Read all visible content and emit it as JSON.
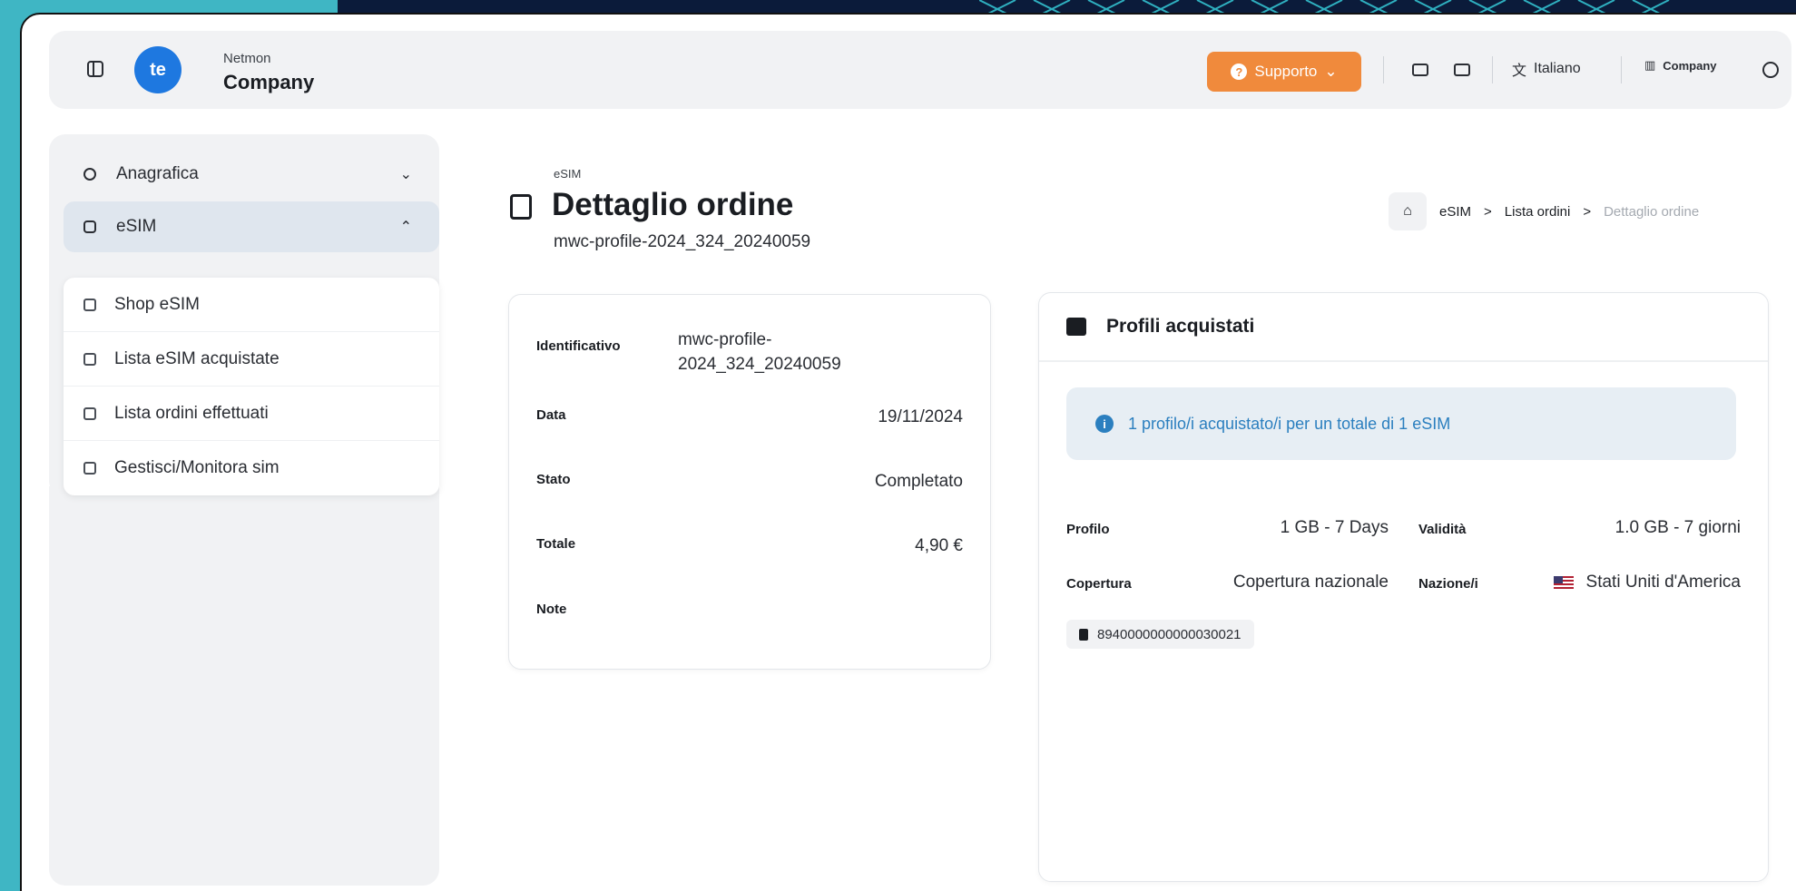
{
  "app": {
    "brand_small": "Netmon",
    "brand_name": "Company",
    "logo_text": "te"
  },
  "header": {
    "support_label": "Supporto",
    "language_label": "Italiano",
    "company_label": "Company"
  },
  "sidebar": {
    "items": [
      {
        "label": "Anagrafica",
        "chevron": "⌄"
      },
      {
        "label": "eSIM",
        "chevron": "⌃"
      }
    ],
    "submenu": [
      {
        "label": "Shop eSIM"
      },
      {
        "label": "Lista eSIM acquistate"
      },
      {
        "label": "Lista ordini effettuati"
      },
      {
        "label": "Gestisci/Monitora sim"
      }
    ]
  },
  "page": {
    "eyebrow": "eSIM",
    "title": "Dettaglio ordine",
    "subtitle": "mwc-profile-2024_324_20240059"
  },
  "breadcrumb": {
    "items": [
      "eSIM",
      "Lista ordini"
    ],
    "current": "Dettaglio ordine",
    "separator": ">"
  },
  "order": {
    "rows": [
      {
        "key": "Identificativo",
        "value": "mwc-profile-2024_324_20240059"
      },
      {
        "key": "Data",
        "value": "19/11/2024"
      },
      {
        "key": "Stato",
        "value": "Completato"
      },
      {
        "key": "Totale",
        "value": "4,90 €"
      },
      {
        "key": "Note",
        "value": ""
      }
    ]
  },
  "profiles": {
    "title": "Profili acquistati",
    "info": "1 profilo/i acquistato/i per un totale di 1 eSIM",
    "profile_label": "Profilo",
    "profile_value": "1 GB - 7 Days",
    "validity_label": "Validità",
    "validity_value": "1.0 GB - 7 giorni",
    "coverage_label": "Copertura",
    "coverage_value": "Copertura nazionale",
    "country_label": "Nazione/i",
    "country_value": "Stati Uniti d'America",
    "iccid": "8940000000000030021"
  },
  "colors": {
    "accent": "#f08a3c",
    "brand": "#1e78e0",
    "info": "#2b7fbf"
  }
}
